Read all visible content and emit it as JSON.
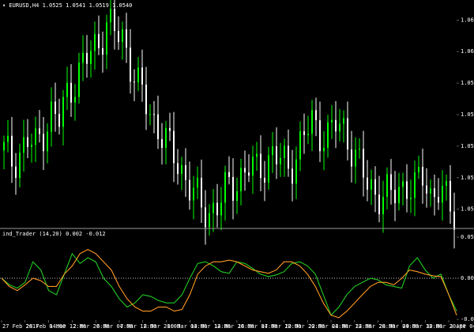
{
  "window": {
    "symbol_info": "▾ EURUSD,H4  1.0525 1.0541 1.0519 1.0540",
    "indicator_info": "ind_Trader (14,20) 0.002 -0.012"
  },
  "colors": {
    "background": "#000000",
    "bull_candle": "#00ff00",
    "bear_candle": "#ffffff",
    "fast_line": "#22cc22",
    "slow_line": "#ff9922",
    "zero_line": "#ffffff",
    "separator": "#9a9a9a"
  },
  "chart_data": [
    {
      "type": "candlestick",
      "y_ticks": [
        "1.0620",
        "1.0605",
        "1.0590",
        "1.0575",
        "1.0560",
        "1.0545",
        "1.0530"
      ],
      "ylim": [
        1.0522,
        1.0625
      ],
      "close_path": [
        1.0558,
        1.0553,
        1.0557,
        1.0562,
        1.056,
        1.0568,
        1.0575,
        1.0572,
        1.0585,
        1.0592,
        1.0598,
        1.0605,
        1.061,
        1.0618,
        1.0614,
        1.0612,
        1.06,
        1.0588,
        1.058,
        1.0572,
        1.0566,
        1.0558,
        1.0552,
        1.0545,
        1.0538,
        1.053,
        1.0529,
        1.0532,
        1.0538,
        1.0542,
        1.0546,
        1.055,
        1.0548,
        1.0552,
        1.0556,
        1.0553,
        1.055,
        1.0556,
        1.0565,
        1.0571,
        1.0567,
        1.0565,
        1.057,
        1.0568,
        1.056,
        1.055,
        1.0542,
        1.0538,
        1.0537,
        1.0536,
        1.054,
        1.0542,
        1.0539,
        1.0546,
        1.0537,
        1.054,
        1.0533,
        1.0528
      ]
    },
    {
      "type": "line",
      "ylim": [
        -0.05,
        0.05
      ],
      "y_ticks": [
        "0.05",
        "0.00",
        "-0.05"
      ],
      "series": [
        {
          "name": "fast",
          "values": [
            0.0,
            -0.008,
            -0.012,
            -0.005,
            0.02,
            0.01,
            -0.015,
            -0.02,
            0.005,
            0.03,
            0.018,
            0.025,
            0.02,
            0.0,
            -0.01,
            -0.025,
            -0.035,
            -0.03,
            -0.02,
            -0.022,
            -0.027,
            -0.03,
            -0.03,
            -0.02,
            0.0,
            0.018,
            0.02,
            0.015,
            0.008,
            0.006,
            0.02,
            0.018,
            0.012,
            0.005,
            0.002,
            0.004,
            0.008,
            0.018,
            0.02,
            0.015,
            0.005,
            -0.02,
            -0.045,
            -0.035,
            -0.02,
            -0.01,
            -0.005,
            0.0,
            -0.002,
            -0.008,
            -0.01,
            -0.012,
            0.015,
            0.025,
            0.01,
            0.0,
            0.005,
            -0.02,
            -0.04
          ]
        },
        {
          "name": "slow",
          "values": [
            0.0,
            -0.01,
            -0.015,
            -0.008,
            0.0,
            -0.003,
            -0.01,
            -0.01,
            0.005,
            0.015,
            0.03,
            0.035,
            0.03,
            0.02,
            0.01,
            -0.01,
            -0.025,
            -0.035,
            -0.04,
            -0.04,
            -0.035,
            -0.035,
            -0.04,
            -0.038,
            -0.02,
            0.005,
            0.015,
            0.02,
            0.02,
            0.022,
            0.02,
            0.015,
            0.01,
            0.008,
            0.006,
            0.01,
            0.02,
            0.02,
            0.015,
            0.005,
            -0.01,
            -0.03,
            -0.045,
            -0.048,
            -0.04,
            -0.03,
            -0.02,
            -0.01,
            -0.005,
            -0.005,
            -0.008,
            0.0,
            0.01,
            0.008,
            0.005,
            0.003,
            0.002,
            -0.02,
            -0.045
          ]
        }
      ]
    }
  ],
  "time_axis": [
    "27 Feb 2017",
    "28 Feb 04:00",
    "1 Mar 12:00",
    "2 Mar 20:00",
    "6 Mar 04:00",
    "7 Mar 12:00",
    "8 Mar 20:00",
    "10 Mar 04:00",
    "13 Mar 12:00",
    "14 Mar 20:00",
    "16 Mar 04:00",
    "17 Mar 12:00",
    "20 Mar 20:00",
    "22 Mar 04:00",
    "23 Mar 12:00",
    "24 Mar 20:00",
    "28 Mar 04:00",
    "29 Mar 12:00",
    "30 Mar 20:00",
    "3 Apr 04:00"
  ]
}
